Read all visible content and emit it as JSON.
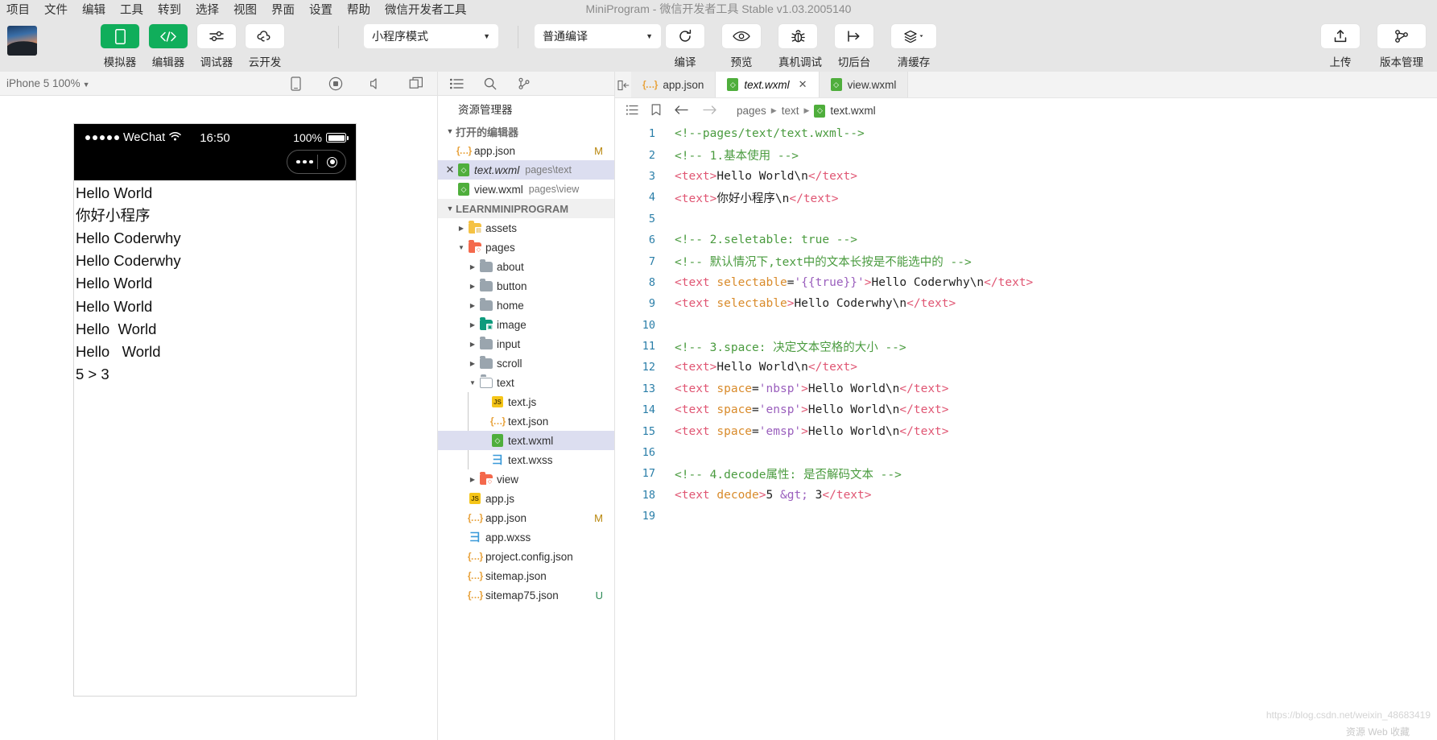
{
  "window": {
    "title": "MiniProgram - 微信开发者工具 Stable v1.03.2005140"
  },
  "menubar": {
    "items": [
      "项目",
      "文件",
      "编辑",
      "工具",
      "转到",
      "选择",
      "视图",
      "界面",
      "设置",
      "帮助",
      "微信开发者工具"
    ]
  },
  "toolbar": {
    "left_buttons": [
      {
        "label": "模拟器",
        "icon": "phone-icon"
      },
      {
        "label": "编辑器",
        "icon": "code-icon"
      },
      {
        "label": "调试器",
        "icon": "sliders-icon"
      },
      {
        "label": "云开发",
        "icon": "cloud-icon"
      }
    ],
    "mode_select": "小程序模式",
    "compile_select": "普通编译",
    "mid_buttons": [
      {
        "label": "编译",
        "icon": "refresh-icon"
      },
      {
        "label": "预览",
        "icon": "eye-icon"
      },
      {
        "label": "真机调试",
        "icon": "bug-icon"
      },
      {
        "label": "切后台",
        "icon": "background-icon"
      },
      {
        "label": "清缓存",
        "icon": "layers-icon"
      }
    ],
    "right_buttons": [
      {
        "label": "上传",
        "icon": "upload-icon"
      },
      {
        "label": "版本管理",
        "icon": "branch-icon"
      }
    ]
  },
  "simulator": {
    "device_selector": "iPhone 5 100%",
    "toolbar_icons": [
      "device-icon",
      "record-icon",
      "volume-icon",
      "window-icon"
    ],
    "status_bar": {
      "carrier": "WeChat",
      "time": "16:50",
      "battery": "100%"
    },
    "page_lines": [
      "Hello World",
      "你好小程序",
      "Hello Coderwhy",
      "Hello Coderwhy",
      "Hello World",
      "Hello World",
      "Hello  World",
      "Hello   World",
      "5 > 3"
    ]
  },
  "explorer": {
    "action_icons": [
      "list-icon",
      "search-icon",
      "branch-icon"
    ],
    "collapse_icon": "collapse-panel-icon",
    "title": "资源管理器",
    "open_editors": {
      "label": "打开的编辑器",
      "items": [
        {
          "name": "app.json",
          "path": "",
          "icon": "json-icon",
          "mark": "M",
          "selected": false,
          "italic": false,
          "closable": false
        },
        {
          "name": "text.wxml",
          "path": "pages\\text",
          "icon": "wxml-icon",
          "mark": "",
          "selected": true,
          "italic": true,
          "closable": true
        },
        {
          "name": "view.wxml",
          "path": "pages\\view",
          "icon": "wxml-icon",
          "mark": "",
          "selected": false,
          "italic": false,
          "closable": false
        }
      ]
    },
    "project": {
      "label": "LEARNMINIPROGRAM",
      "tree": [
        {
          "name": "assets",
          "type": "folder-yellow",
          "depth": 1,
          "twisty": "collapsed"
        },
        {
          "name": "pages",
          "type": "folder-orange",
          "depth": 1,
          "twisty": "expanded"
        },
        {
          "name": "about",
          "type": "folder-gray",
          "depth": 2,
          "twisty": "collapsed"
        },
        {
          "name": "button",
          "type": "folder-gray",
          "depth": 2,
          "twisty": "collapsed"
        },
        {
          "name": "home",
          "type": "folder-gray",
          "depth": 2,
          "twisty": "collapsed"
        },
        {
          "name": "image",
          "type": "folder-teal",
          "depth": 2,
          "twisty": "collapsed"
        },
        {
          "name": "input",
          "type": "folder-gray",
          "depth": 2,
          "twisty": "collapsed"
        },
        {
          "name": "scroll",
          "type": "folder-gray",
          "depth": 2,
          "twisty": "collapsed"
        },
        {
          "name": "text",
          "type": "folder-open",
          "depth": 2,
          "twisty": "expanded"
        },
        {
          "name": "text.js",
          "type": "js",
          "depth": 3,
          "twisty": ""
        },
        {
          "name": "text.json",
          "type": "json",
          "depth": 3,
          "twisty": ""
        },
        {
          "name": "text.wxml",
          "type": "wxml",
          "depth": 3,
          "twisty": "",
          "selected": true
        },
        {
          "name": "text.wxss",
          "type": "wxss",
          "depth": 3,
          "twisty": ""
        },
        {
          "name": "view",
          "type": "folder-orange",
          "depth": 2,
          "twisty": "collapsed"
        },
        {
          "name": "app.js",
          "type": "js",
          "depth": 1,
          "twisty": ""
        },
        {
          "name": "app.json",
          "type": "json",
          "depth": 1,
          "twisty": "",
          "mark": "M"
        },
        {
          "name": "app.wxss",
          "type": "wxss",
          "depth": 1,
          "twisty": ""
        },
        {
          "name": "project.config.json",
          "type": "json",
          "depth": 1,
          "twisty": ""
        },
        {
          "name": "sitemap.json",
          "type": "json",
          "depth": 1,
          "twisty": ""
        },
        {
          "name": "sitemap75.json",
          "type": "json",
          "depth": 1,
          "twisty": "",
          "mark": "U"
        }
      ]
    }
  },
  "editor": {
    "tabs": [
      {
        "label": "app.json",
        "icon": "json-icon",
        "active": false,
        "closable": false
      },
      {
        "label": "text.wxml",
        "icon": "wxml-icon",
        "active": true,
        "closable": true
      },
      {
        "label": "view.wxml",
        "icon": "wxml-icon",
        "active": false,
        "closable": false
      }
    ],
    "breadcrumb": {
      "icons": [
        "outline-icon",
        "bookmark-icon",
        "back-arrow-icon",
        "forward-arrow-icon"
      ],
      "parts": [
        "pages",
        "text",
        "text.wxml"
      ]
    },
    "code_lines": [
      {
        "n": 1,
        "tokens": [
          {
            "t": "<!--pages/text/text.wxml-->",
            "c": "c-cm"
          }
        ]
      },
      {
        "n": 2,
        "tokens": [
          {
            "t": "<!-- 1.基本使用 -->",
            "c": "c-cm"
          }
        ]
      },
      {
        "n": 3,
        "tokens": [
          {
            "t": "<text>",
            "c": "c-tag"
          },
          {
            "t": "Hello World\\n",
            "c": "c-txt"
          },
          {
            "t": "</text>",
            "c": "c-tag"
          }
        ]
      },
      {
        "n": 4,
        "tokens": [
          {
            "t": "<text>",
            "c": "c-tag"
          },
          {
            "t": "你好小程序\\n",
            "c": "c-txt"
          },
          {
            "t": "</text>",
            "c": "c-tag"
          }
        ]
      },
      {
        "n": 5,
        "tokens": []
      },
      {
        "n": 6,
        "tokens": [
          {
            "t": "<!-- 2.seletable: true -->",
            "c": "c-cm"
          }
        ]
      },
      {
        "n": 7,
        "tokens": [
          {
            "t": "<!-- 默认情况下,text中的文本长按是不能选中的 -->",
            "c": "c-cm"
          }
        ]
      },
      {
        "n": 8,
        "tokens": [
          {
            "t": "<text ",
            "c": "c-tag"
          },
          {
            "t": "selectable",
            "c": "c-attr"
          },
          {
            "t": "=",
            "c": "c-txt"
          },
          {
            "t": "'{{true}}'",
            "c": "c-str"
          },
          {
            "t": ">",
            "c": "c-tag"
          },
          {
            "t": "Hello Coderwhy\\n",
            "c": "c-txt"
          },
          {
            "t": "</text>",
            "c": "c-tag"
          }
        ]
      },
      {
        "n": 9,
        "tokens": [
          {
            "t": "<text ",
            "c": "c-tag"
          },
          {
            "t": "selectable",
            "c": "c-attr"
          },
          {
            "t": ">",
            "c": "c-tag"
          },
          {
            "t": "Hello Coderwhy\\n",
            "c": "c-txt"
          },
          {
            "t": "</text>",
            "c": "c-tag"
          }
        ]
      },
      {
        "n": 10,
        "tokens": []
      },
      {
        "n": 11,
        "tokens": [
          {
            "t": "<!-- 3.space: 决定文本空格的大小 -->",
            "c": "c-cm"
          }
        ]
      },
      {
        "n": 12,
        "tokens": [
          {
            "t": "<text>",
            "c": "c-tag"
          },
          {
            "t": "Hello World\\n",
            "c": "c-txt"
          },
          {
            "t": "</text>",
            "c": "c-tag"
          }
        ]
      },
      {
        "n": 13,
        "tokens": [
          {
            "t": "<text ",
            "c": "c-tag"
          },
          {
            "t": "space",
            "c": "c-attr"
          },
          {
            "t": "=",
            "c": "c-txt"
          },
          {
            "t": "'nbsp'",
            "c": "c-str"
          },
          {
            "t": ">",
            "c": "c-tag"
          },
          {
            "t": "Hello World\\n",
            "c": "c-txt"
          },
          {
            "t": "</text>",
            "c": "c-tag"
          }
        ]
      },
      {
        "n": 14,
        "tokens": [
          {
            "t": "<text ",
            "c": "c-tag"
          },
          {
            "t": "space",
            "c": "c-attr"
          },
          {
            "t": "=",
            "c": "c-txt"
          },
          {
            "t": "'ensp'",
            "c": "c-str"
          },
          {
            "t": ">",
            "c": "c-tag"
          },
          {
            "t": "Hello World\\n",
            "c": "c-txt"
          },
          {
            "t": "</text>",
            "c": "c-tag"
          }
        ]
      },
      {
        "n": 15,
        "tokens": [
          {
            "t": "<text ",
            "c": "c-tag"
          },
          {
            "t": "space",
            "c": "c-attr"
          },
          {
            "t": "=",
            "c": "c-txt"
          },
          {
            "t": "'emsp'",
            "c": "c-str"
          },
          {
            "t": ">",
            "c": "c-tag"
          },
          {
            "t": "Hello World\\n",
            "c": "c-txt"
          },
          {
            "t": "</text>",
            "c": "c-tag"
          }
        ]
      },
      {
        "n": 16,
        "tokens": []
      },
      {
        "n": 17,
        "tokens": [
          {
            "t": "<!-- 4.decode属性: 是否解码文本 -->",
            "c": "c-cm"
          }
        ]
      },
      {
        "n": 18,
        "tokens": [
          {
            "t": "<text ",
            "c": "c-tag"
          },
          {
            "t": "decode",
            "c": "c-attr"
          },
          {
            "t": ">",
            "c": "c-tag"
          },
          {
            "t": "5 ",
            "c": "c-txt"
          },
          {
            "t": "&gt;",
            "c": "c-ent"
          },
          {
            "t": " 3",
            "c": "c-txt"
          },
          {
            "t": "</text>",
            "c": "c-tag"
          }
        ]
      },
      {
        "n": 19,
        "tokens": []
      }
    ]
  },
  "watermark": {
    "line1": "https://blog.csdn.net/weixin_48683419",
    "line2": "资源 Web 收藏"
  },
  "colors": {
    "accent_green": "#10ae5b",
    "toolbar_bg": "#e6e6e6",
    "selection_blue": "#dcdef0",
    "comment_green": "#4a9b3f",
    "tag_pink": "#e05673",
    "attr_orange": "#d98b2b",
    "string_purple": "#9a5fbd"
  }
}
